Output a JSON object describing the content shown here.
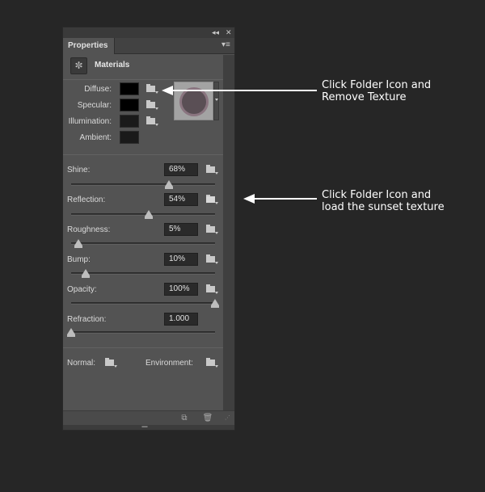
{
  "panel": {
    "tab_label": "Properties",
    "collapse_glyph": "◂◂",
    "close_glyph": "✕",
    "menu_glyph": "▾≡",
    "header_icon": "materials-icon",
    "header_title": "Materials",
    "surface": [
      {
        "label": "Diffuse:",
        "color": "#000000",
        "folder": "folder-icon"
      },
      {
        "label": "Specular:",
        "color": "#000000",
        "folder": "folder-icon"
      },
      {
        "label": "Illumination:",
        "color": "#1a1a1a",
        "folder": "folder-icon"
      },
      {
        "label": "Ambient:",
        "color": "#1a1a1a"
      }
    ],
    "texture_thumbnail": "texture-ring",
    "properties": [
      {
        "label": "Shine:",
        "value": "68%",
        "level": 0.68,
        "folder": "folder-icon"
      },
      {
        "label": "Reflection:",
        "value": "54%",
        "level": 0.54,
        "folder": "texture-loaded-icon"
      },
      {
        "label": "Roughness:",
        "value": "5%",
        "level": 0.05,
        "folder": "folder-icon"
      },
      {
        "label": "Bump:",
        "value": "10%",
        "level": 0.1,
        "folder": "folder-icon"
      },
      {
        "label": "Opacity:",
        "value": "100%",
        "level": 1.0,
        "folder": "folder-icon"
      },
      {
        "label": "Refraction:",
        "value": "1.000",
        "level": 0.0
      }
    ],
    "normal_label": "Normal:",
    "environment_label": "Environment:",
    "footer_icons": [
      "new-material-icon",
      "trash-icon"
    ]
  },
  "annotations": {
    "top_line1": "Click Folder Icon and",
    "top_line2": "Remove Texture",
    "mid_line1": "Click Folder Icon and",
    "mid_line2": "load the sunset texture"
  },
  "colors": {
    "background": "#262626",
    "panel": "#535353",
    "arrow": "#ffffff"
  }
}
